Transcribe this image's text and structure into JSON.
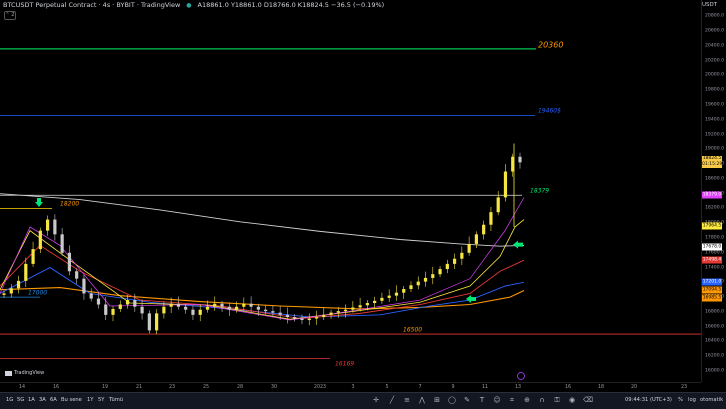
{
  "legend": {
    "title": "BTCUSDT Perpetual Contract · 4s · BYBIT · TradingView",
    "ohlc": "A18861.0 Y18861.0 D18766.0 K18824.5 −36.5 (−0.19%)",
    "collapse_label": "⌃ 2"
  },
  "price_axis": {
    "currency": "USDT",
    "ticks": [
      "20800.0",
      "20600.0",
      "20400.0",
      "20200.0",
      "20000.0",
      "19800.0",
      "19600.0",
      "19400.0",
      "19200.0",
      "19000.0",
      "18800.0",
      "18600.0",
      "18400.0",
      "18200.0",
      "18000.0",
      "17800.0",
      "17600.0",
      "17400.0",
      "17200.0",
      "17000.0",
      "16800.0",
      "16600.0",
      "16400.0",
      "16200.0",
      "16000.0"
    ],
    "tags": [
      {
        "label": "18824.5",
        "sub": "01:15:29",
        "price": 18824.5,
        "color": "#f7c948",
        "text": "#000"
      },
      {
        "label": "18379.0",
        "price": 18379,
        "color": "#e040fb",
        "text": "#fff"
      },
      {
        "label": "17964.5",
        "price": 17964.5,
        "color": "#ffeb3b",
        "text": "#000"
      },
      {
        "label": "17678.0",
        "price": 17678,
        "color": "#ffffff",
        "text": "#000"
      },
      {
        "label": "17498.4",
        "price": 17498.4,
        "color": "#e53935",
        "text": "#fff"
      },
      {
        "label": "17201.0",
        "price": 17201,
        "color": "#2962ff",
        "text": "#fff"
      },
      {
        "label": "17094.5",
        "price": 17094.5,
        "color": "#ff9800",
        "text": "#000"
      },
      {
        "label": "16985.5",
        "price": 16985.5,
        "color": "#ff9800",
        "text": "#000"
      }
    ]
  },
  "horizontal_levels": [
    {
      "label": "20360",
      "price": 20360,
      "color": "#00c853",
      "label_color": "#ff9800"
    },
    {
      "label": "19460$",
      "price": 19460,
      "color": "#2962ff",
      "label_color": "#2962ff"
    },
    {
      "label": "18379",
      "price": 18379,
      "color": "#e0e0e0",
      "label_color": "#00e676"
    },
    {
      "label": "18200",
      "price": 18200,
      "color": "#ffd600",
      "label_color": "#ff9800"
    },
    {
      "label": "17000",
      "price": 17000,
      "color": "#1e88e5",
      "label_color": "#1e88e5"
    },
    {
      "label": "16500",
      "price": 16500,
      "color": "#e53935",
      "label_color": "#ff9800"
    },
    {
      "label": "16169",
      "price": 16169,
      "color": "#e53935",
      "label_color": "#e53935"
    }
  ],
  "time_axis": [
    "14",
    "16",
    "19",
    "21",
    "23",
    "25",
    "28",
    "30",
    "2023",
    "3",
    "5",
    "7",
    "9",
    "11",
    "13",
    "16",
    "18",
    "20",
    "23"
  ],
  "watermark": "TradingView",
  "toolbar": {
    "timeframes": [
      "1G",
      "5G",
      "1A",
      "3A",
      "6A",
      "Bu sene",
      "1Y",
      "5Y",
      "Tümü"
    ],
    "time": "09:44:31 (UTC+3)",
    "percent": "%",
    "log": "log",
    "auto": "otomatik"
  },
  "chart_data": {
    "type": "candlestick",
    "symbol": "BTCUSDT Perpetual Contract",
    "interval": "4s",
    "ylim": [
      16000,
      20900
    ],
    "last_price": 18824.5,
    "close_path": [
      17050,
      17120,
      17220,
      17450,
      17650,
      17900,
      18050,
      17850,
      17600,
      17350,
      17250,
      17050,
      16980,
      16900,
      16760,
      16840,
      16900,
      16960,
      16870,
      16780,
      16550,
      16780,
      16870,
      16910,
      16870,
      16830,
      16760,
      16830,
      16870,
      16910,
      16870,
      16830,
      16870,
      16910,
      16870,
      16830,
      16810,
      16790,
      16760,
      16730,
      16710,
      16690,
      16710,
      16730,
      16760,
      16790,
      16810,
      16830,
      16860,
      16890,
      16920,
      16950,
      16990,
      17020,
      17060,
      17110,
      17160,
      17210,
      17260,
      17310,
      17380,
      17450,
      17520,
      17600,
      17720,
      17850,
      17980,
      18150,
      18350,
      18700,
      18900,
      18824.5
    ]
  }
}
